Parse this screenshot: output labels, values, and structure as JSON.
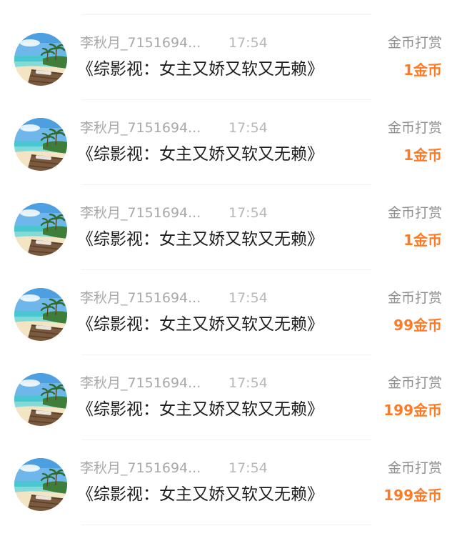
{
  "colors": {
    "accent_orange": "#ff7a24",
    "title_text": "#1e1e1e",
    "secondary_text": "#a9a9a9",
    "divider": "#f2f2f2"
  },
  "rewards": [
    {
      "avatar_icon": "beach-avatar-icon",
      "username": "李秋月_7151694...",
      "time": "17:54",
      "book_title": "《综影视：女主又娇又软又无赖》",
      "reward_type": "金币打赏",
      "amount": "1金币"
    },
    {
      "avatar_icon": "beach-avatar-icon",
      "username": "李秋月_7151694...",
      "time": "17:54",
      "book_title": "《综影视：女主又娇又软又无赖》",
      "reward_type": "金币打赏",
      "amount": "1金币"
    },
    {
      "avatar_icon": "beach-avatar-icon",
      "username": "李秋月_7151694...",
      "time": "17:54",
      "book_title": "《综影视：女主又娇又软又无赖》",
      "reward_type": "金币打赏",
      "amount": "1金币"
    },
    {
      "avatar_icon": "beach-avatar-icon",
      "username": "李秋月_7151694...",
      "time": "17:54",
      "book_title": "《综影视：女主又娇又软又无赖》",
      "reward_type": "金币打赏",
      "amount": "99金币"
    },
    {
      "avatar_icon": "beach-avatar-icon",
      "username": "李秋月_7151694...",
      "time": "17:54",
      "book_title": "《综影视：女主又娇又软又无赖》",
      "reward_type": "金币打赏",
      "amount": "199金币"
    },
    {
      "avatar_icon": "beach-avatar-icon",
      "username": "李秋月_7151694...",
      "time": "17:54",
      "book_title": "《综影视：女主又娇又软又无赖》",
      "reward_type": "金币打赏",
      "amount": "199金币"
    }
  ]
}
